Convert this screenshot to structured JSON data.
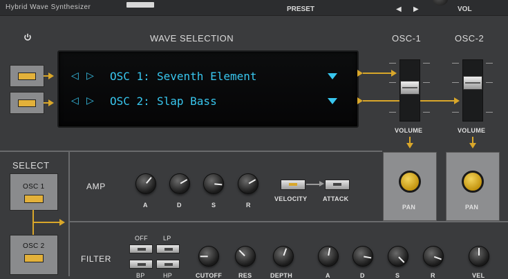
{
  "header": {
    "product_name": "Hybrid  Wave  Synthesizer",
    "preset_label": "PRESET",
    "prev_arrow": "◀",
    "next_arrow": "▶",
    "vol_label": "VOL"
  },
  "wave_selection": {
    "title": "WAVE SELECTION",
    "osc1": {
      "label": "OSC 1:",
      "wave": "Seventh Element"
    },
    "osc2": {
      "label": "OSC 2:",
      "wave": "Slap Bass"
    },
    "arrow_left": "◁",
    "arrow_right": "▷"
  },
  "osc_volume": {
    "osc1": {
      "title": "OSC-1",
      "label": "VOLUME",
      "pan_label": "PAN"
    },
    "osc2": {
      "title": "OSC-2",
      "label": "VOLUME",
      "pan_label": "PAN"
    }
  },
  "select": {
    "title": "SELECT",
    "osc1": "OSC 1",
    "osc2": "OSC 2"
  },
  "amp": {
    "title": "AMP",
    "knobs": [
      "A",
      "D",
      "S",
      "R"
    ],
    "velocity_label": "VELOCITY",
    "attack_label": "ATTACK"
  },
  "filter": {
    "title": "FILTER",
    "off_label": "OFF",
    "lp_label": "LP",
    "bp_label": "BP",
    "hp_label": "HP",
    "knob_labels": [
      "CUTOFF",
      "RES",
      "DEPTH",
      "A",
      "D",
      "S",
      "R",
      "VEL"
    ]
  },
  "colors": {
    "accent": "#d9a72a",
    "lcd": "#38c6ee",
    "panel": "#3a3b3d"
  },
  "icons": {
    "power": "power-icon"
  }
}
